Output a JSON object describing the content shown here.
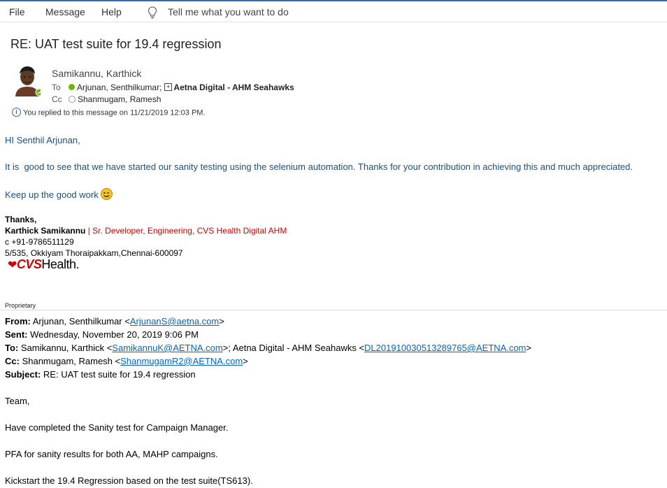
{
  "menubar": {
    "items": [
      "File",
      "Message",
      "Help"
    ],
    "tell_me": "Tell me what you want to do"
  },
  "email": {
    "subject": "RE: UAT test suite for 19.4 regression",
    "sender": "Samikannu, Karthick",
    "to_label": "To",
    "to_person": "Arjunan, Senthilkumar;",
    "to_group": "Aetna Digital - AHM Seahawks",
    "cc_label": "Cc",
    "cc_person": "Shanmugam, Ramesh",
    "reply_info": "You replied to this message on 11/21/2019 12:03 PM."
  },
  "message": {
    "greeting": "HI Senthil Arjunan,",
    "line1": "It is  good to see that we have started our sanity testing using the selenium automation. Thanks for your contribution in achieving this and much appreciated.",
    "line2": "Keep up the good work",
    "thanks": "Thanks,",
    "sig_name": "Karthick Samikannu",
    "sig_sep": " | ",
    "sig_title": "Sr. Developer, Engineering, CVS Health Digital AHM",
    "sig_phone": "c +91-9786511129",
    "sig_address": "5/535, Okkiyam Thoraipakkam,Chennai-600097",
    "logo_cvs": "CVS",
    "logo_health": "Health."
  },
  "quoted": {
    "proprietary": "Proprietary",
    "from_label": "From:",
    "from_name": " Arjunan, Senthilkumar <",
    "from_email": "ArjunanS@aetna.com",
    "from_end": ">",
    "sent_label": "Sent:",
    "sent_value": " Wednesday, November 20, 2019 9:06 PM",
    "to_label": "To:",
    "to_name1": " Samikannu, Karthick <",
    "to_email1": "SamikannuK@AETNA.com",
    "to_mid": ">; Aetna Digital - AHM Seahawks <",
    "to_email2": "DL201910030513289765@AETNA.com",
    "to_end": ">",
    "cc_label": "Cc:",
    "cc_name": " Shanmugam, Ramesh <",
    "cc_email": "ShanmugamR2@AETNA.com",
    "cc_end": ">",
    "subject_label": "Subject:",
    "subject_value": " RE: UAT test suite for 19.4 regression",
    "body1": "Team,",
    "body2": "Have completed the Sanity test for Campaign Manager.",
    "body3": "PFA for sanity results for both AA, MAHP campaigns.",
    "body4": "Kickstart the 19.4 Regression based on the test suite(TS613)."
  }
}
